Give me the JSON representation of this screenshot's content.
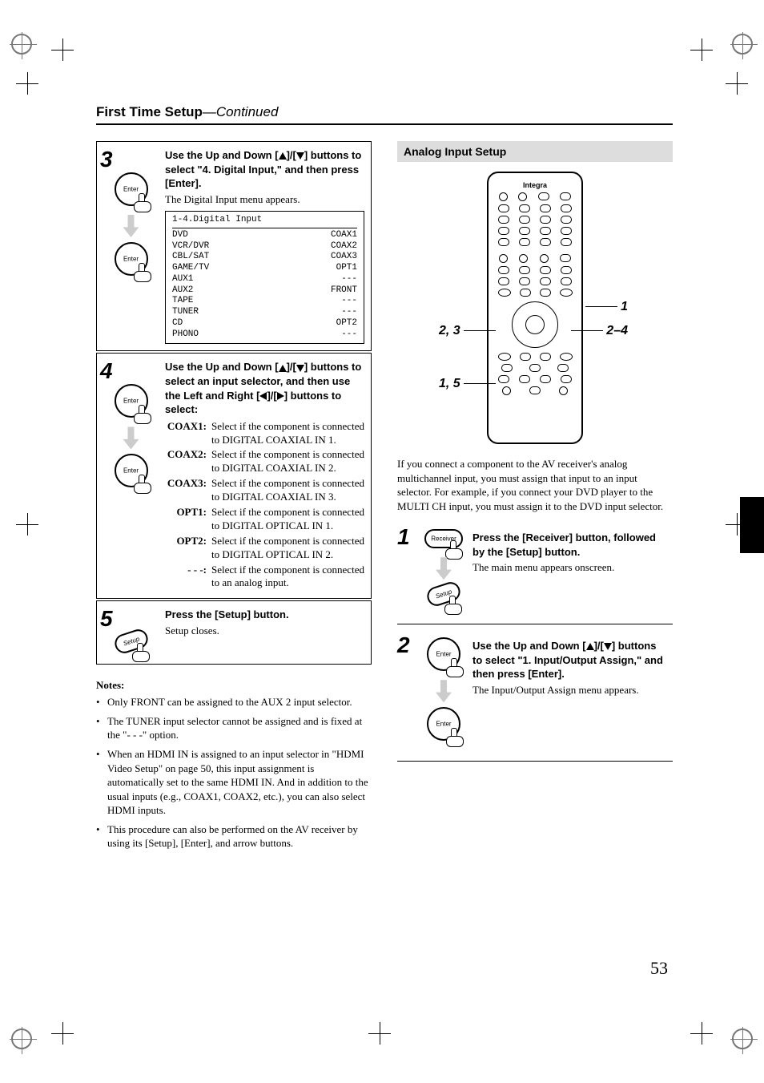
{
  "header": {
    "title": "First Time Setup",
    "continued": "—Continued"
  },
  "left": {
    "step3": {
      "num": "3",
      "bold_a": "Use the Up and Down [",
      "bold_b": "]/[",
      "bold_c": "] buttons to select \"4. Digital Input,\" and then press [Enter].",
      "text": "The Digital Input menu appears.",
      "menu_title": "1-4.Digital Input",
      "rows": [
        {
          "name": "DVD",
          "val": "COAX1"
        },
        {
          "name": "VCR/DVR",
          "val": "COAX2"
        },
        {
          "name": "CBL/SAT",
          "val": "COAX3"
        },
        {
          "name": "GAME/TV",
          "val": "OPT1"
        },
        {
          "name": "AUX1",
          "val": "---"
        },
        {
          "name": "AUX2",
          "val": "FRONT"
        },
        {
          "name": "TAPE",
          "val": "---"
        },
        {
          "name": "TUNER",
          "val": "---"
        },
        {
          "name": "CD",
          "val": "OPT2"
        },
        {
          "name": "PHONO",
          "val": "---"
        }
      ]
    },
    "step4": {
      "num": "4",
      "bold_a": "Use the Up and Down [",
      "bold_b": "]/[",
      "bold_c": "] buttons to select an input selector, and then use the Left and Right [",
      "bold_d": "]/[",
      "bold_e": "] buttons to select:",
      "defs": [
        {
          "label": "COAX1:",
          "text": "Select if the component is connected to DIGITAL COAXIAL IN 1."
        },
        {
          "label": "COAX2:",
          "text": "Select if the component is connected to DIGITAL COAXIAL IN 2."
        },
        {
          "label": "COAX3:",
          "text": "Select if the component is connected to DIGITAL COAXIAL IN 3."
        },
        {
          "label": "OPT1:",
          "text": "Select if the component is connected to DIGITAL OPTICAL IN 1."
        },
        {
          "label": "OPT2:",
          "text": "Select if the component is connected to DIGITAL OPTICAL IN 2."
        },
        {
          "label": "- - -:",
          "text": "Select if the component is connected to an analog input."
        }
      ]
    },
    "step5": {
      "num": "5",
      "bold": "Press the [Setup] button.",
      "text": "Setup closes."
    },
    "notes_h": "Notes:",
    "notes": [
      "Only FRONT can be assigned to the AUX 2 input selector.",
      "The TUNER input selector cannot be assigned and is fixed at the \"- - -\" option.",
      "When an HDMI IN  is assigned to an input selector in \"HDMI Video Setup\" on page 50, this input assignment is automatically set to the same HDMI IN. And in addition to the usual inputs (e.g., COAX1, COAX2, etc.), you can also select HDMI inputs.",
      "This procedure can also be performed on the AV receiver by using its [Setup], [Enter], and arrow buttons."
    ]
  },
  "right": {
    "section": "Analog Input Setup",
    "brand": "Integra",
    "call_left": {
      "a": "2, 3",
      "b": "1, 5"
    },
    "call_right": {
      "a": "1",
      "b": "2–4"
    },
    "para": "If you connect a component to the AV receiver's analog multichannel input, you must assign that input to an input selector. For example, if you connect your DVD player to the MULTI CH input, you must assign it to the DVD input selector.",
    "step1": {
      "num": "1",
      "bold": "Press the [Receiver] button, followed by the [Setup] button.",
      "text": "The main menu appears onscreen."
    },
    "step2": {
      "num": "2",
      "bold_a": "Use the Up and Down [",
      "bold_b": "]/[",
      "bold_c": "] buttons to select \"1. Input/Output Assign,\" and then press [Enter].",
      "text": "The Input/Output Assign menu appears."
    }
  },
  "page_num": "53"
}
